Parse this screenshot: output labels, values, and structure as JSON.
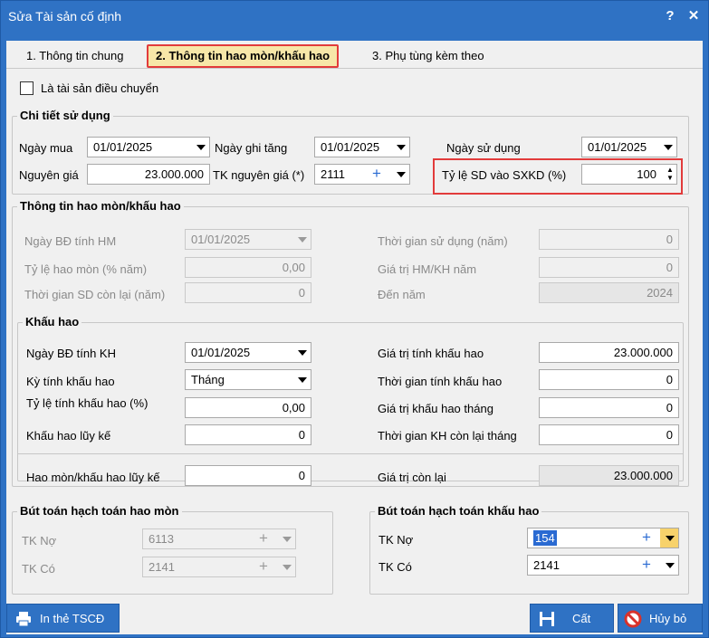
{
  "window": {
    "title": "Sửa Tài sản cố định",
    "help": "?",
    "close": "✕"
  },
  "tabs": [
    {
      "label": "1. Thông tin chung"
    },
    {
      "label": "2. Thông tin hao mòn/khấu hao"
    },
    {
      "label": "3. Phụ tùng kèm theo"
    }
  ],
  "transfer_checkbox": {
    "label": "Là tài sản điều chuyển",
    "checked": false
  },
  "usage": {
    "title": "Chi tiết sử dụng",
    "purchase_date_label": "Ngày mua",
    "purchase_date": "01/01/2025",
    "record_date_label": "Ngày ghi tăng",
    "record_date": "01/01/2025",
    "use_date_label": "Ngày sử dụng",
    "use_date": "01/01/2025",
    "cost_label": "Nguyên giá",
    "cost": "23.000.000",
    "cost_account_label": "TK nguyên giá (*)",
    "cost_account": "2111",
    "ratio_label": "Tỷ lệ SD vào SXKD (%)",
    "ratio": "100"
  },
  "wear": {
    "title": "Thông tin hao mòn/khấu hao",
    "start_date_label": "Ngày BĐ tính HM",
    "start_date": "01/01/2025",
    "rate_label": "Tỷ lệ hao mòn (% năm)",
    "rate": "0,00",
    "remaining_label": "Thời gian SD còn lại (năm)",
    "remaining": "0",
    "use_time_label": "Thời gian sử dụng (năm)",
    "use_time": "0",
    "year_value_label": "Giá trị HM/KH năm",
    "year_value": "0",
    "to_year_label": "Đến năm",
    "to_year": "2024"
  },
  "depr": {
    "title": "Khấu hao",
    "start_date_label": "Ngày BĐ tính KH",
    "start_date": "01/01/2025",
    "period_label": "Kỳ tính khấu hao",
    "period": "Tháng",
    "rate_label": "Tỷ lệ tính khấu hao (%)",
    "rate": "0,00",
    "accum_label": "Khấu hao lũy kế",
    "accum": "0",
    "value_label": "Giá trị tính khấu hao",
    "value": "23.000.000",
    "time_label": "Thời gian tính khấu hao",
    "time": "0",
    "month_value_label": "Giá trị khấu hao tháng",
    "month_value": "0",
    "remain_months_label": "Thời gian KH còn lại tháng",
    "remain_months": "0",
    "wear_accum_label": "Hao mòn/khấu hao lũy kế",
    "wear_accum": "0",
    "residual_label": "Giá trị còn lại",
    "residual": "23.000.000"
  },
  "wear_entry": {
    "title": "Bút toán hạch toán hao mòn",
    "debit_label": "TK Nợ",
    "debit": "6113",
    "credit_label": "TK Có",
    "credit": "2141"
  },
  "depr_entry": {
    "title": "Bút toán hạch toán khấu hao",
    "debit_label": "TK Nợ",
    "debit": "154",
    "credit_label": "TK Có",
    "credit": "2141"
  },
  "footer": {
    "print_label": "In thẻ TSCĐ",
    "save_label": "Cất",
    "cancel_label": "Hủy bỏ"
  },
  "colors": {
    "accent": "#2f72c4",
    "highlight": "#e23b3b",
    "active_tab": "#f7e7a8"
  }
}
